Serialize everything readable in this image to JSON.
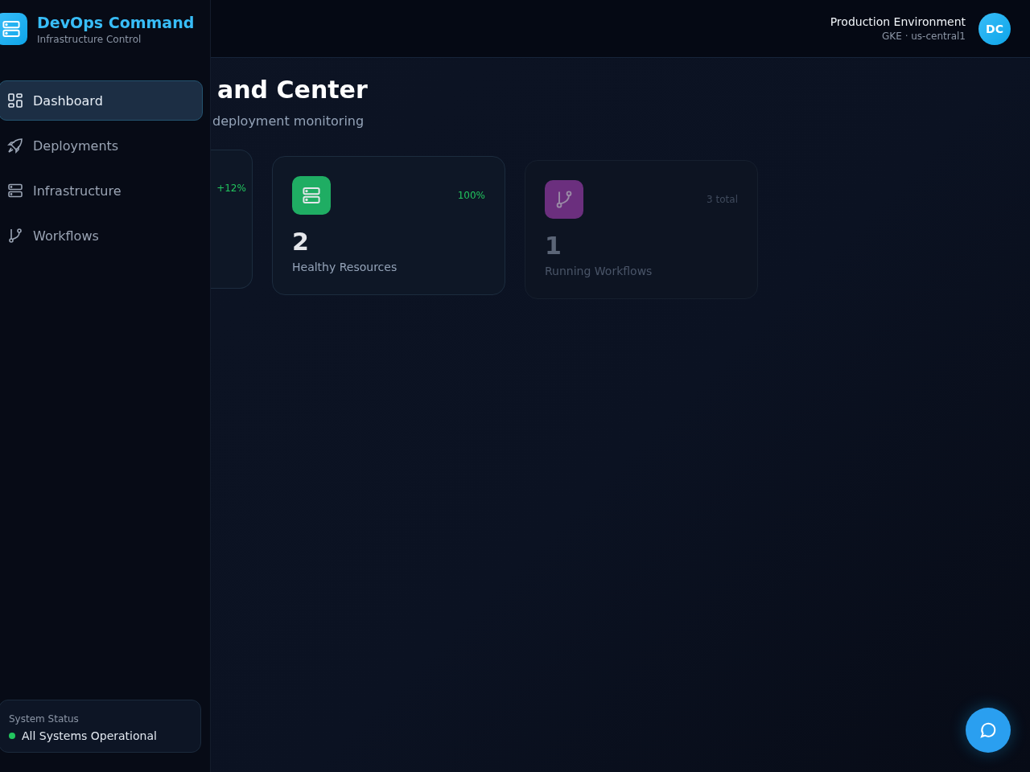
{
  "brand": {
    "title": "DevOps Command",
    "subtitle": "Infrastructure Control"
  },
  "sidebar": {
    "items": [
      {
        "label": "Dashboard",
        "selected": true
      },
      {
        "label": "Deployments",
        "selected": false
      },
      {
        "label": "Infrastructure",
        "selected": false
      },
      {
        "label": "Workflows",
        "selected": false
      }
    ]
  },
  "system_status": {
    "label": "System Status",
    "text": "All Systems Operational",
    "color": "#22c55e"
  },
  "header": {
    "environment": "Production Environment",
    "cluster": "GKE · us-central1",
    "avatar": "DC"
  },
  "page": {
    "title": "and Center",
    "subtitle": "deployment monitoring"
  },
  "stats": [
    {
      "kind": "partial",
      "badge": "+12%"
    },
    {
      "kind": "full",
      "color": "#1fad63",
      "badge": "100%",
      "value": "2",
      "label": "Healthy Resources",
      "muted": false
    },
    {
      "kind": "full",
      "color": "#6b2f7e",
      "badge": "3 total",
      "value": "1",
      "label": "Running Workflows",
      "muted": true
    }
  ]
}
